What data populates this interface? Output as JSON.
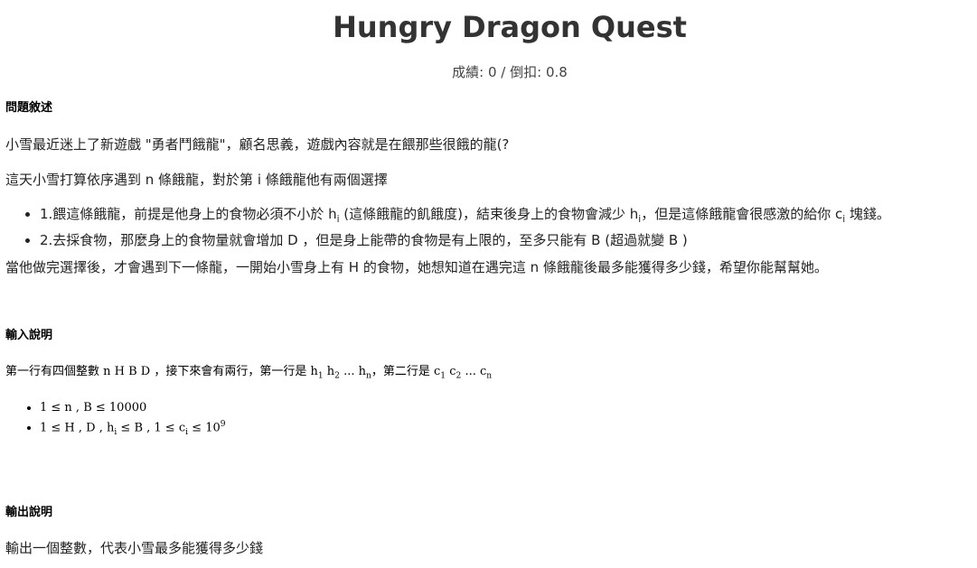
{
  "title": "Hungry Dragon Quest",
  "score_line": "成績: 0 / 倒扣: 0.8",
  "problem": {
    "heading": "問題敘述",
    "intro": "小雪最近迷上了新遊戲 \"勇者鬥餓龍\"，顧名思義，遊戲內容就是在餵那些很餓的龍(?",
    "line2_pre": "這天小雪打算依序遇到 n 條餓龍，對於第 i 條餓龍他有兩個選擇",
    "choice1": {
      "p1": "1.餵這條餓龍，前提是他身上的食物必須不小於 h",
      "sub1": "i",
      "p2": " (這條餓龍的飢餓度)，結束後身上的食物會減少 h",
      "sub2": "i",
      "p3": "，但是這條餓龍會很感激的給你 c",
      "sub3": "i",
      "p4": " 塊錢。"
    },
    "choice2": "2.去採食物，那麼身上的食物量就會增加 D ，但是身上能帶的食物是有上限的，至多只能有 B (超過就變 B )",
    "closing": "當他做完選擇後，才會遇到下一條龍，一開始小雪身上有 H 的食物，她想知道在遇完這 n 條餓龍後最多能獲得多少錢，希望你能幫幫她。"
  },
  "input": {
    "heading": "輸入說明",
    "desc": {
      "p1": "第一行有四個整數 n H B D ，接下來會有兩行，第一行是 h",
      "s1": "1",
      "p2": " h",
      "s2": "2",
      "p3": " ... h",
      "s3": "n",
      "p4": "，第二行是 c",
      "s4": "1",
      "p5": " c",
      "s5": "2",
      "p6": " ... c",
      "s6": "n"
    },
    "constraint1": "1 ≤ n , B ≤ 10000",
    "constraint2": {
      "p1": "1 ≤ H , D , h",
      "s1": "i",
      "p2": " ≤ B , 1 ≤ c",
      "s2": "i",
      "p3": " ≤ 10",
      "sup": "9"
    }
  },
  "output": {
    "heading": "輸出說明",
    "desc": "輸出一個整數，代表小雪最多能獲得多少錢"
  }
}
